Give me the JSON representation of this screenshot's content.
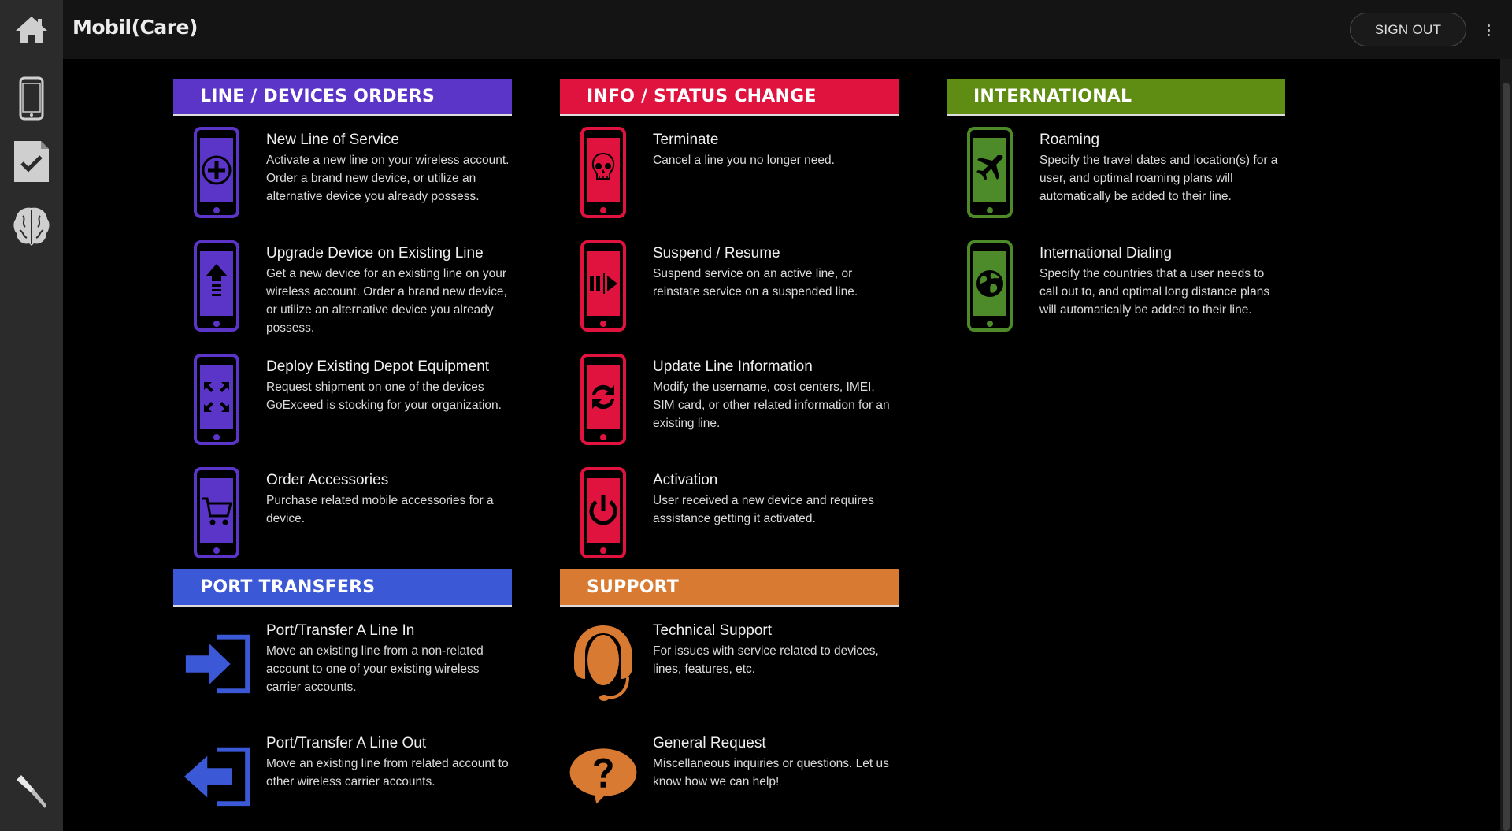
{
  "app": {
    "logo": "Mobil(Care)"
  },
  "topbar": {
    "signout_label": "SIGN OUT"
  },
  "colors": {
    "purple": "#5b35c8",
    "red": "#e0133f",
    "green": "#5f8c12",
    "blue": "#3b59d6",
    "orange": "#d97a33"
  },
  "sections": {
    "line_devices": {
      "heading": "LINE / DEVICES ORDERS",
      "items": [
        {
          "title": "New Line of Service",
          "desc": "Activate a new line on your wireless account. Order a brand new device, or utilize an alternative device you already possess."
        },
        {
          "title": "Upgrade Device on Existing Line",
          "desc": "Get a new device for an existing line on your wireless account. Order a brand new device, or utilize an alternative device you already possess."
        },
        {
          "title": "Deploy Existing Depot Equipment",
          "desc": "Request shipment on one of the devices GoExceed is stocking for your organization."
        },
        {
          "title": "Order Accessories",
          "desc": "Purchase related mobile accessories for a device."
        }
      ]
    },
    "info_status": {
      "heading": "INFO / STATUS CHANGE",
      "items": [
        {
          "title": "Terminate",
          "desc": "Cancel a line you no longer need."
        },
        {
          "title": "Suspend / Resume",
          "desc": "Suspend service on an active line, or reinstate service on a suspended line."
        },
        {
          "title": "Update Line Information",
          "desc": "Modify the username, cost centers, IMEI, SIM card, or other related information for an existing line."
        },
        {
          "title": "Activation",
          "desc": "User received a new device and requires assistance getting it activated."
        }
      ]
    },
    "international": {
      "heading": "INTERNATIONAL",
      "items": [
        {
          "title": "Roaming",
          "desc": "Specify the travel dates and location(s) for a user, and optimal roaming plans will automatically be added to their line."
        },
        {
          "title": "International Dialing",
          "desc": "Specify the countries that a user needs to call out to, and optimal long distance plans will automatically be added to their line."
        }
      ]
    },
    "port_transfers": {
      "heading": "PORT TRANSFERS",
      "items": [
        {
          "title": "Port/Transfer A Line In",
          "desc": "Move an existing line from a non-related account to one of your existing wireless carrier accounts."
        },
        {
          "title": "Port/Transfer A Line Out",
          "desc": "Move an existing line from related account to other wireless carrier accounts."
        }
      ]
    },
    "support": {
      "heading": "SUPPORT",
      "items": [
        {
          "title": "Technical Support",
          "desc": "For issues with service related to devices, lines, features, etc."
        },
        {
          "title": "General Request",
          "desc": "Miscellaneous inquiries or questions. Let us know how we can help!"
        }
      ]
    }
  }
}
